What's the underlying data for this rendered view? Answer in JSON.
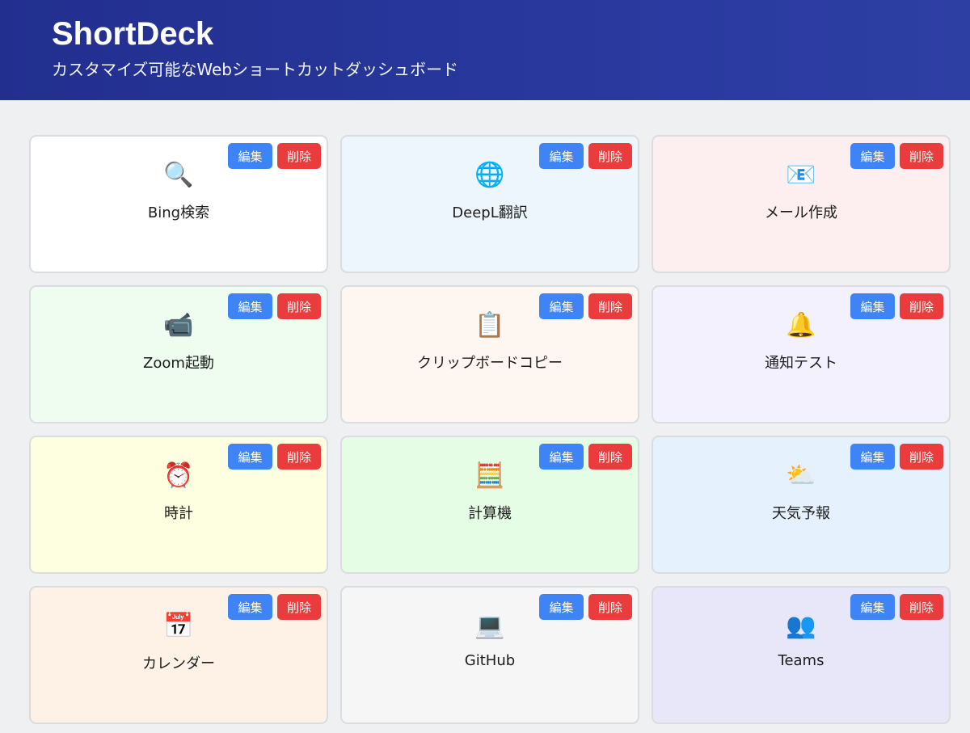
{
  "header": {
    "title": "ShortDeck",
    "subtitle": "カスタマイズ可能なWebショートカットダッシュボード"
  },
  "buttons": {
    "edit_label": "編集",
    "delete_label": "削除"
  },
  "colors": {
    "header_bg": "#26339a",
    "edit_button": "#3e84f7",
    "delete_button": "#ea3c3c",
    "page_bg": "#eff0f1"
  },
  "cards": [
    {
      "label": "Bing検索",
      "icon": "magnifier-icon",
      "glyph": "🔍",
      "bg": "#ffffff"
    },
    {
      "label": "DeepL翻訳",
      "icon": "globe-icon",
      "glyph": "🌐",
      "bg": "#eef6fd"
    },
    {
      "label": "メール作成",
      "icon": "email-icon",
      "glyph": "📧",
      "bg": "#fdefef"
    },
    {
      "label": "Zoom起動",
      "icon": "video-camera-icon",
      "glyph": "📹",
      "bg": "#eefdef"
    },
    {
      "label": "クリップボードコピー",
      "icon": "clipboard-icon",
      "glyph": "📋",
      "bg": "#fef6f1"
    },
    {
      "label": "通知テスト",
      "icon": "bell-icon",
      "glyph": "🔔",
      "bg": "#f2f1fd"
    },
    {
      "label": "時計",
      "icon": "alarm-clock-icon",
      "glyph": "⏰",
      "bg": "#fefee0"
    },
    {
      "label": "計算機",
      "icon": "abacus-icon",
      "glyph": "🧮",
      "bg": "#e5fde4"
    },
    {
      "label": "天気予報",
      "icon": "sun-cloud-icon",
      "glyph": "⛅",
      "bg": "#e5f2fd"
    },
    {
      "label": "カレンダー",
      "icon": "calendar-icon",
      "glyph": "📅",
      "bg": "#fef2e6"
    },
    {
      "label": "GitHub",
      "icon": "laptop-icon",
      "glyph": "💻",
      "bg": "#f6f6f6"
    },
    {
      "label": "Teams",
      "icon": "people-icon",
      "glyph": "👥",
      "bg": "#e8e7f9"
    }
  ]
}
